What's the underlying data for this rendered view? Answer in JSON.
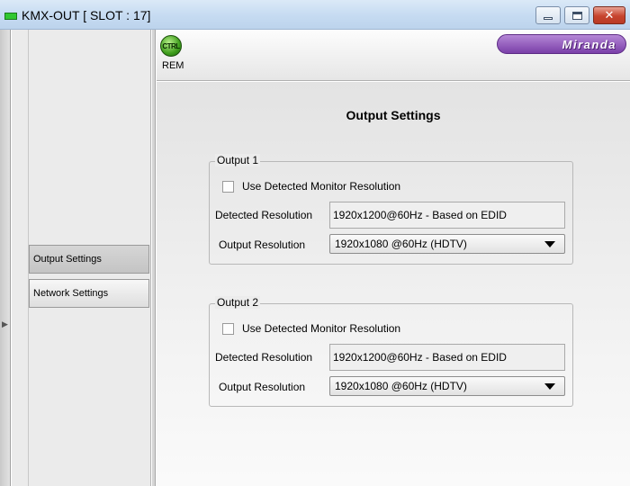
{
  "window": {
    "title": "KMX-OUT [ SLOT : 17]",
    "close_glyph": "✕"
  },
  "sidebar": {
    "items": [
      {
        "label": "Output Settings",
        "active": true
      },
      {
        "label": "Network Settings",
        "active": false
      }
    ]
  },
  "header": {
    "ctrl_badge": "CTRL",
    "rem_label": "REM",
    "logo_text": "Miranda"
  },
  "main": {
    "title": "Output Settings",
    "groups": [
      {
        "legend": "Output 1",
        "checkbox_label": "Use Detected Monitor Resolution",
        "checkbox_checked": false,
        "detected_label": "Detected Resolution",
        "detected_value": "1920x1200@60Hz - Based on EDID",
        "output_label": "Output Resolution",
        "output_value": "1920x1080 @60Hz (HDTV)"
      },
      {
        "legend": "Output 2",
        "checkbox_label": "Use Detected Monitor Resolution",
        "checkbox_checked": false,
        "detected_label": "Detected Resolution",
        "detected_value": "1920x1200@60Hz - Based on EDID",
        "output_label": "Output Resolution",
        "output_value": "1920x1080 @60Hz (HDTV)"
      }
    ]
  },
  "colors": {
    "logo_purple": "#7a3fa8",
    "status_green": "#3e9d1c",
    "close_red": "#c7442e"
  }
}
